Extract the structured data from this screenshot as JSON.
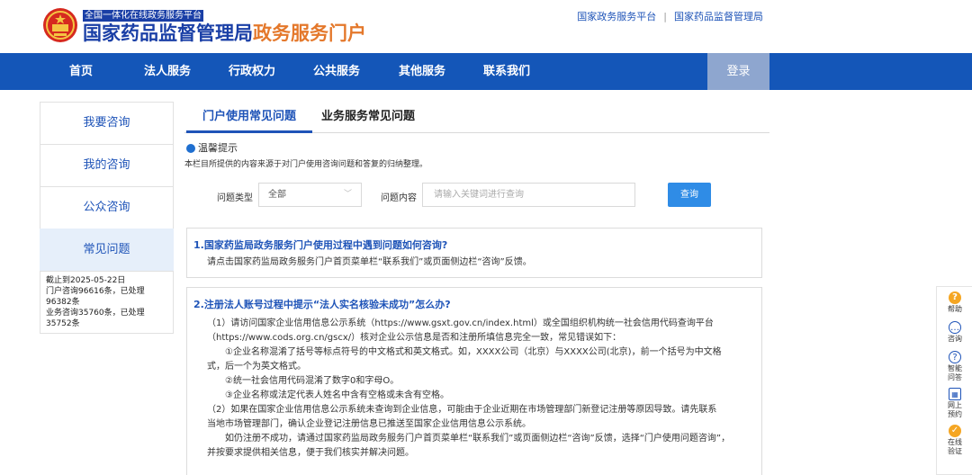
{
  "header": {
    "platform_tag": "全国一体化在线政务服务平台",
    "title_part1": "国家药品监督管理局",
    "title_part2": "政务服务门户",
    "top_links": [
      "国家政务服务平台",
      "国家药品监督管理局"
    ],
    "top_link_separator": "|"
  },
  "nav": {
    "items": [
      "首页",
      "法人服务",
      "行政权力",
      "公共服务",
      "其他服务",
      "联系我们"
    ],
    "login": "登录"
  },
  "sidebar": {
    "items": [
      "我要咨询",
      "我的咨询",
      "公众咨询",
      "常见问题"
    ],
    "active_index": 3,
    "stats": [
      "截止到2025-05-22日",
      "门户咨询96616条，已处理96382条",
      "业务咨询35760条，已处理35752条"
    ]
  },
  "tabs": [
    "门户使用常见问题",
    "业务服务常见问题"
  ],
  "tip": {
    "title": "温馨提示",
    "desc": "本栏目所提供的内容来源于对门户使用咨询问题和答复的归纳整理。"
  },
  "filter": {
    "type_label": "问题类型",
    "type_value": "全部",
    "content_label": "问题内容",
    "content_placeholder": "请输入关键词进行查询",
    "query_button": "查询"
  },
  "faqs": [
    {
      "question": "1.国家药监局政务服务门户使用过程中遇到问题如何咨询?",
      "answer": [
        "请点击国家药监局政务服务门户首页菜单栏“联系我们”或页面侧边栏“咨询”反馈。"
      ]
    },
    {
      "question": "2.注册法人账号过程中提示“法人实名核验未成功”怎么办?",
      "answer": [
        "（1）请访问国家企业信用信息公示系统（https://www.gsxt.gov.cn/index.html）或全国组织机构统一社会信用代码查询平台",
        "（https://www.cods.org.cn/gscx/）核对企业公示信息是否和注册所填信息完全一致，常见错误如下：",
        "①企业名称混淆了括号等标点符号的中文格式和英文格式。如，XXXX公司（北京）与XXXX公司(北京)，前一个括号为中文格",
        "式，后一个为英文格式。",
        "②统一社会信用代码混淆了数字0和字母O。",
        "③企业名称或法定代表人姓名中含有空格或未含有空格。",
        "（2）如果在国家企业信用信息公示系统未查询到企业信息，可能由于企业近期在市场管理部门新登记注册等原因导致。请先联系",
        "当地市场管理部门，确认企业登记注册信息已推送至国家企业信用信息公示系统。",
        "如仍注册不成功，请通过国家药监局政务服务门户首页菜单栏“联系我们”或页面侧边栏“咨询”反馈，选择“门户使用问题咨询”，",
        "并按要求提供相关信息，便于我们核实并解决问题。"
      ]
    }
  ],
  "float_bar": [
    {
      "label": "帮助",
      "icon": "help-icon"
    },
    {
      "label": "咨询",
      "icon": "chat-icon"
    },
    {
      "label": "智能问答",
      "icon": "ai-qa-icon"
    },
    {
      "label": "网上预约",
      "icon": "calendar-icon"
    },
    {
      "label": "在线验证",
      "icon": "verify-icon"
    }
  ],
  "colors": {
    "nav_bg": "#1456b8",
    "title_blue": "#1a3fa6",
    "title_orange": "#e4782b",
    "link_blue": "#1f54b8",
    "accent": "#f5a623"
  }
}
